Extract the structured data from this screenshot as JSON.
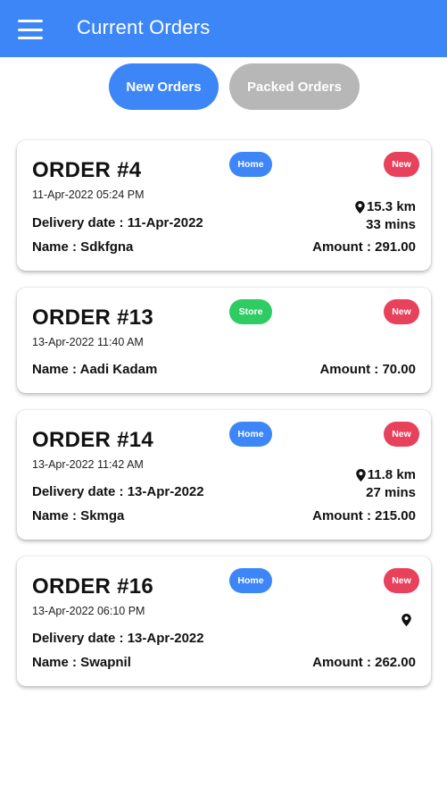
{
  "appbar": {
    "title": "Current Orders",
    "color": "#3d86f7"
  },
  "tabs": [
    {
      "label": "New Orders",
      "active": true
    },
    {
      "label": "Packed Orders",
      "active": false
    }
  ],
  "orders": [
    {
      "title": "ORDER #4",
      "timestamp": "11-Apr-2022 05:24 PM",
      "type": "Home",
      "status": "New",
      "distance": "15.3 km",
      "duration": "33 mins",
      "delivery": "Delivery date : 11-Apr-2022",
      "name": "Name : Sdkfgna",
      "amount": "Amount : 291.00"
    },
    {
      "title": "ORDER #13",
      "timestamp": "13-Apr-2022 11:40 AM",
      "type": "Store",
      "status": "New",
      "name": "Name : Aadi Kadam",
      "amount": "Amount : 70.00"
    },
    {
      "title": "ORDER #14",
      "timestamp": "13-Apr-2022 11:42 AM",
      "type": "Home",
      "status": "New",
      "distance": "11.8 km",
      "duration": "27 mins",
      "delivery": "Delivery date : 13-Apr-2022",
      "name": "Name : Skmga",
      "amount": "Amount : 215.00"
    },
    {
      "title": "ORDER #16",
      "timestamp": "13-Apr-2022 06:10 PM",
      "type": "Home",
      "status": "New",
      "delivery": "Delivery date : 13-Apr-2022",
      "name": "Name : Swapnil",
      "amount": "Amount : 262.00"
    }
  ],
  "colors": {
    "home_badge": "#3d86f7",
    "store_badge": "#2ecc63",
    "new_badge": "#e8415c",
    "inactive_tab": "#b7b7b7"
  },
  "icons": {
    "menu": "hamburger-icon",
    "location": "map-pin-icon"
  }
}
